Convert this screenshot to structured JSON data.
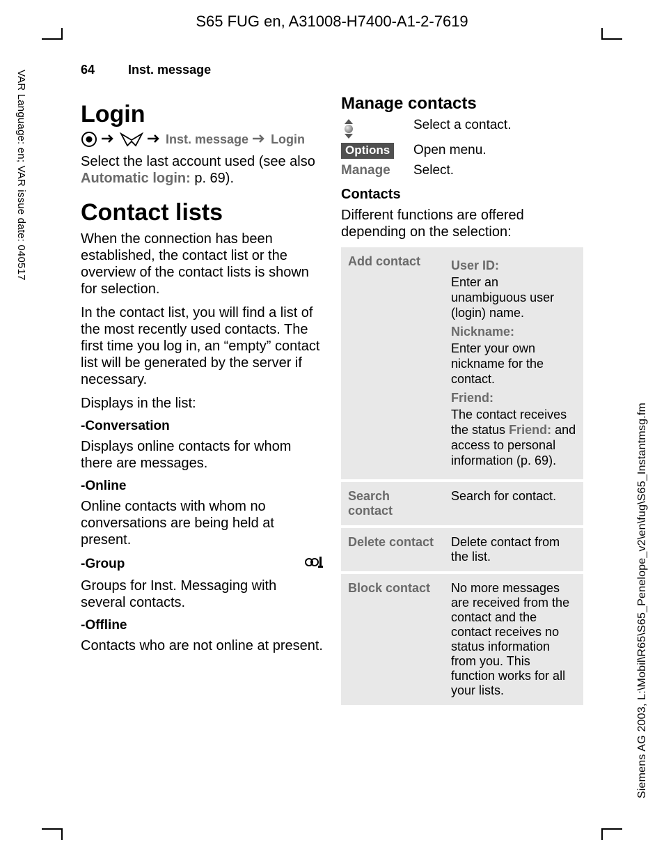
{
  "header": "S65 FUG en, A31008-H7400-A1-2-7619",
  "side_left": "VAR Language: en; VAR issue date: 040517",
  "side_right": "Siemens AG 2003, L:\\Mobil\\R65\\S65_Penelope_v2\\en\\fug\\S65_Instantmsg.fm",
  "running": {
    "page": "64",
    "title": "Inst. message"
  },
  "left": {
    "h_login": "Login",
    "nav": {
      "it1": "Inst. message",
      "it2": "Login"
    },
    "login_p1a": "Select the last account used (see also ",
    "login_p1b": "Automatic login:",
    "login_p1c": " p. 69).",
    "h_contact": "Contact lists",
    "p_conn": "When the connection has been established, the contact list or the overview of the contact lists is shown for selection.",
    "p_list": "In the contact list, you will find a list of the most recently used contacts. The first time you log in, an “empty” contact list will be generated by the server if necessary.",
    "p_disp": "Displays in the list:",
    "conv_h": "-Conversation",
    "conv_p": "Displays online contacts for whom there are messages.",
    "onl_h": "-Online",
    "onl_p": "Online contacts with whom no conversations are being held at present.",
    "grp_h": "-Group",
    "grp_p": "Groups for Inst. Messaging with several contacts.",
    "off_h": "-Offline",
    "off_p": "Contacts who are not online at present."
  },
  "right": {
    "h_manage": "Manage contacts",
    "row_sel": "Select a contact.",
    "row_opt_k": "Options",
    "row_opt_v": "Open menu.",
    "row_mng_k": "Manage",
    "row_mng_v": "Select.",
    "contacts_h": "Contacts",
    "contacts_p": "Different functions are offered depending on the selection:",
    "tbl": {
      "r1k": "Add contact",
      "r1_user_h": "User ID:",
      "r1_user_b": "Enter an unambiguous user (login) name.",
      "r1_nick_h": "Nickname:",
      "r1_nick_b": "Enter your own nickname for the contact.",
      "r1_fr_h": "Friend:",
      "r1_fr_b1": "The contact receives the status ",
      "r1_fr_b2": "Friend:",
      "r1_fr_b3": " and access to personal information (p. 69).",
      "r2k": "Search contact",
      "r2v": "Search for contact.",
      "r3k": "Delete contact",
      "r3v": "Delete contact from the list.",
      "r4k": "Block contact",
      "r4v": "No more messages are received from the contact and the contact receives no status information from you. This function works for all your lists."
    }
  }
}
